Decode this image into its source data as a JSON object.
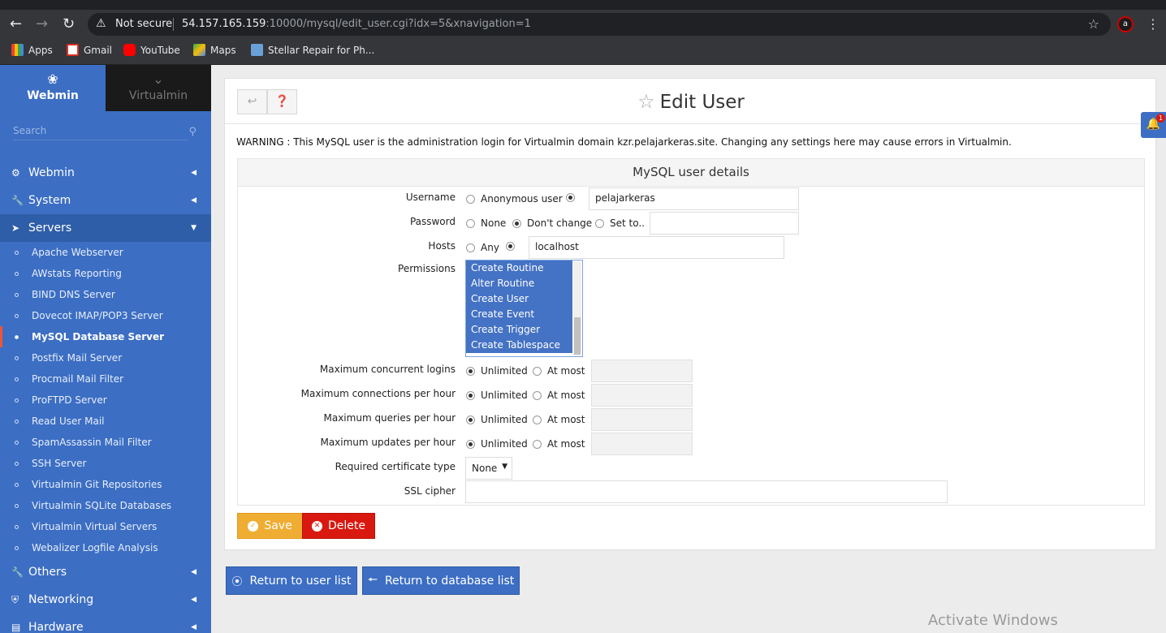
{
  "browser": {
    "security_label": "Not secure",
    "url_host": "54.157.165.159",
    "url_path": ":10000/mysql/edit_user.cgi?idx=5&xnavigation=1",
    "bookmarks": [
      "Apps",
      "Gmail",
      "YouTube",
      "Maps",
      "Stellar Repair for Ph..."
    ],
    "profile_initial": "a"
  },
  "sidebar": {
    "tabs": [
      "Webmin",
      "Virtualmin"
    ],
    "search_placeholder": "Search",
    "sections": [
      "Webmin",
      "System",
      "Servers",
      "Others",
      "Networking",
      "Hardware"
    ],
    "items": [
      "Apache Webserver",
      "AWstats Reporting",
      "BIND DNS Server",
      "Dovecot IMAP/POP3 Server",
      "MySQL Database Server",
      "Postfix Mail Server",
      "Procmail Mail Filter",
      "ProFTPD Server",
      "Read User Mail",
      "SpamAssassin Mail Filter",
      "SSH Server",
      "Virtualmin Git Repositories",
      "Virtualmin SQLite Databases",
      "Virtualmin Virtual Servers",
      "Webalizer Logfile Analysis"
    ],
    "active_item": "MySQL Database Server"
  },
  "page": {
    "title": "Edit User",
    "warning": "WARNING : This MySQL user is the administration login for Virtualmin domain kzr.pelajarkeras.site. Changing any settings here may cause errors in Virtualmin.",
    "section_title": "MySQL user details",
    "notification_count": "1"
  },
  "form": {
    "username": {
      "label": "Username",
      "opt1": "Anonymous user",
      "value": "pelajarkeras",
      "selected": "custom"
    },
    "password": {
      "label": "Password",
      "opt1": "None",
      "opt2": "Don't change",
      "opt3": "Set to..",
      "selected": "Don't change"
    },
    "hosts": {
      "label": "Hosts",
      "opt1": "Any",
      "value": "localhost",
      "selected": "custom"
    },
    "permissions": {
      "label": "Permissions",
      "visible_options": [
        "Create Routine",
        "Alter Routine",
        "Create User",
        "Create Event",
        "Create Trigger",
        "Create Tablespace"
      ]
    },
    "limits": [
      {
        "label": "Maximum concurrent logins",
        "opt1": "Unlimited",
        "opt2": "At most",
        "selected": "Unlimited"
      },
      {
        "label": "Maximum connections per hour",
        "opt1": "Unlimited",
        "opt2": "At most",
        "selected": "Unlimited"
      },
      {
        "label": "Maximum queries per hour",
        "opt1": "Unlimited",
        "opt2": "At most",
        "selected": "Unlimited"
      },
      {
        "label": "Maximum updates per hour",
        "opt1": "Unlimited",
        "opt2": "At most",
        "selected": "Unlimited"
      }
    ],
    "cert": {
      "label": "Required certificate type",
      "value": "None"
    },
    "cipher": {
      "label": "SSL cipher",
      "value": ""
    }
  },
  "buttons": {
    "save": "Save",
    "delete": "Delete",
    "return_users": "Return to user list",
    "return_dbs": "Return to database list"
  },
  "watermark": "Activate Windows",
  "colors": {
    "sidebar": "#3c6ec3",
    "save": "#f0ad33",
    "delete": "#d9190f",
    "accent": "#3d6ec4"
  }
}
